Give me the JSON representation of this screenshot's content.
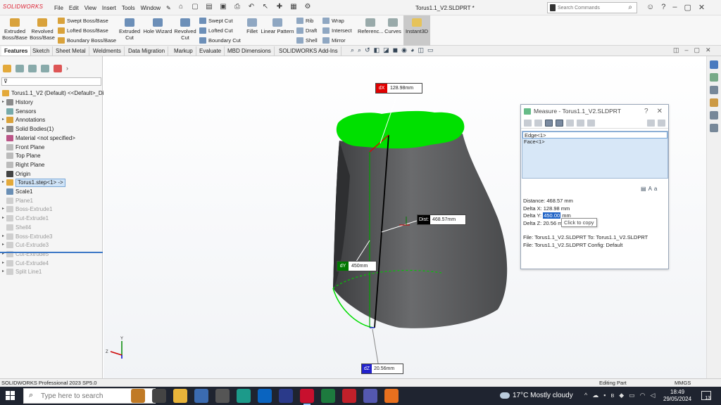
{
  "app": {
    "logo": "SOLIDWORKS",
    "menu": [
      "File",
      "Edit",
      "View",
      "Insert",
      "Tools",
      "Window"
    ],
    "doc_title": "Torus1.1_V2.SLDPRT *",
    "search_placeholder": "Search Commands"
  },
  "ribbon": {
    "extruded_boss": "Extruded Boss/Base",
    "revolved_boss": "Revolved Boss/Base",
    "swept_boss": "Swept Boss/Base",
    "lofted_boss": "Lofted Boss/Base",
    "boundary_boss": "Boundary Boss/Base",
    "extruded_cut": "Extruded Cut",
    "hole_wizard": "Hole Wizard",
    "revolved_cut": "Revolved Cut",
    "swept_cut": "Swept Cut",
    "lofted_cut": "Lofted Cut",
    "boundary_cut": "Boundary Cut",
    "fillet": "Fillet",
    "linear_pattern": "Linear Pattern",
    "rib": "Rib",
    "draft": "Draft",
    "shell": "Shell",
    "wrap": "Wrap",
    "intersect": "Intersect",
    "mirror": "Mirror",
    "reference": "Referenc...",
    "curves": "Curves",
    "instant3d": "Instant3D"
  },
  "tabs": [
    "Features",
    "Sketch",
    "Sheet Metal",
    "Weldments",
    "Data Migration",
    "Markup",
    "Evaluate",
    "MBD Dimensions",
    "SOLIDWORKS Add-Ins"
  ],
  "tree": {
    "root": "Torus1.1_V2 (Default) <<Default>_Di",
    "items": [
      {
        "label": "History",
        "grey": false,
        "arrow": true
      },
      {
        "label": "Sensors",
        "grey": false,
        "arrow": false
      },
      {
        "label": "Annotations",
        "grey": false,
        "arrow": true
      },
      {
        "label": "Solid Bodies(1)",
        "grey": false,
        "arrow": true
      },
      {
        "label": "Material <not specified>",
        "grey": false,
        "arrow": false
      },
      {
        "label": "Front Plane",
        "grey": false,
        "arrow": false
      },
      {
        "label": "Top Plane",
        "grey": false,
        "arrow": false
      },
      {
        "label": "Right Plane",
        "grey": false,
        "arrow": false
      },
      {
        "label": "Origin",
        "grey": false,
        "arrow": false
      },
      {
        "label": "Torus1.step<1> ->",
        "grey": false,
        "arrow": true,
        "selected": true
      },
      {
        "label": "Scale1",
        "grey": false,
        "arrow": false
      },
      {
        "label": "Plane1",
        "grey": true,
        "arrow": false
      },
      {
        "label": "Boss-Extrude1",
        "grey": true,
        "arrow": true
      },
      {
        "label": "Cut-Extrude1",
        "grey": true,
        "arrow": true
      },
      {
        "label": "Shell4",
        "grey": true,
        "arrow": false
      },
      {
        "label": "Boss-Extrude3",
        "grey": true,
        "arrow": true
      },
      {
        "label": "Cut-Extrude3",
        "grey": true,
        "arrow": true
      },
      {
        "label": "Cut-Extrude5",
        "grey": true,
        "arrow": true
      },
      {
        "label": "Cut-Extrude4",
        "grey": true,
        "arrow": true
      },
      {
        "label": "Split Line1",
        "grey": true,
        "arrow": true
      }
    ]
  },
  "callouts": {
    "dx_tag": "dX",
    "dx_value": "128.98mm",
    "dist_tag": "Dist:",
    "dist_value": "468.57mm",
    "dy_tag": "dY",
    "dy_value": "450mm",
    "dz_tag": "dZ",
    "dz_value": "20.56mm"
  },
  "measure": {
    "title": "Measure - Torus1.1_V2.SLDPRT",
    "selections": [
      "Edge<1>",
      "Face<1>"
    ],
    "distance": "Distance: 468.57 mm",
    "delta_x": "Delta X: 128.98 mm",
    "delta_y_label": "Delta Y: ",
    "delta_y_value": "450.00",
    "delta_y_unit": " mm",
    "delta_z": "Delta Z: 20.56 mm",
    "tooltip": "Click to copy",
    "file_line1": "File: Torus1.1_V2.SLDPRT To: Torus1.1_V2.SLDPRT",
    "file_line2": "File: Torus1.1_V2.SLDPRT Config: Default"
  },
  "status": {
    "left": "SOLIDWORKS Professional 2023 SP5.0",
    "mode": "Editing Part",
    "units": "MMGS"
  },
  "taskbar": {
    "search_placeholder": "Type here to search",
    "weather": "17°C  Mostly cloudy",
    "time": "18:49",
    "date": "29/05/2024",
    "notif_count": "13"
  },
  "colors": {
    "green_face": "#00e000",
    "part_grey": "#5f6062",
    "dx_red": "#e00000",
    "dy_green": "#007700",
    "dz_blue": "#2222cc"
  }
}
